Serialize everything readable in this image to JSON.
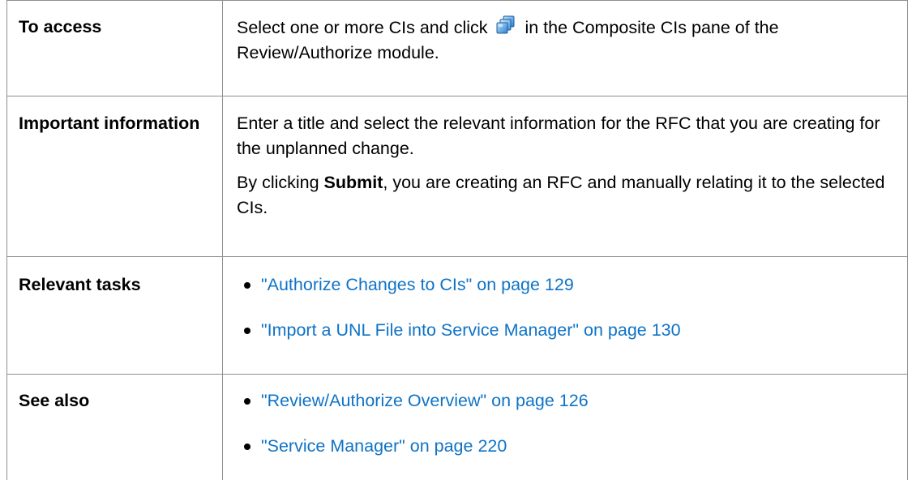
{
  "colors": {
    "link": "#0f73c6",
    "border": "#8f8f8f",
    "text": "#000000"
  },
  "rows": {
    "access": {
      "label": "To access",
      "text_before_icon": "Select one or more CIs and click",
      "icon": "composite-ci-icon",
      "text_after_icon": "in the Composite CIs pane of the Review/Authorize module."
    },
    "important": {
      "label": "Important information",
      "paragraph1": "Enter a title and select the relevant information for the RFC that you are creating for the unplanned change.",
      "paragraph2_prefix": "By clicking ",
      "paragraph2_bold": "Submit",
      "paragraph2_suffix": ", you are creating an RFC and manually relating it to the selected CIs."
    },
    "tasks": {
      "label": "Relevant tasks",
      "links": [
        "\"Authorize Changes to CIs\" on page 129",
        "\"Import a UNL File into Service Manager\" on page 130"
      ]
    },
    "see_also": {
      "label": "See also",
      "links": [
        "\"Review/Authorize Overview\" on page 126",
        "\"Service Manager\" on page 220"
      ]
    }
  }
}
